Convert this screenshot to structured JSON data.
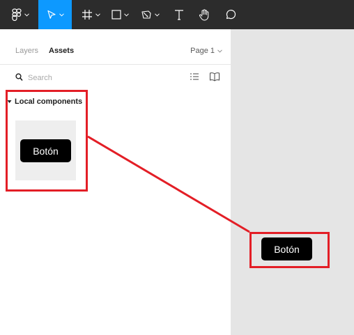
{
  "toolbar": {
    "tools": [
      {
        "name": "main-menu",
        "icon": "figma-logo-icon",
        "dropdown": true
      },
      {
        "name": "move",
        "icon": "cursor-arrow-icon",
        "dropdown": true,
        "active": true
      },
      {
        "name": "frame",
        "icon": "frame-hash-icon",
        "dropdown": true
      },
      {
        "name": "shape",
        "icon": "rectangle-icon",
        "dropdown": true
      },
      {
        "name": "pen",
        "icon": "pen-icon",
        "dropdown": true
      },
      {
        "name": "text",
        "icon": "text-T-icon",
        "dropdown": false
      },
      {
        "name": "hand",
        "icon": "hand-icon",
        "dropdown": false
      },
      {
        "name": "comment",
        "icon": "comment-bubble-icon",
        "dropdown": false
      }
    ],
    "active_color": "#0d99ff",
    "bg_color": "#2c2c2c"
  },
  "panel": {
    "tabs": {
      "layers": "Layers",
      "assets": "Assets"
    },
    "page_selector": "Page 1",
    "search": {
      "placeholder": "Search",
      "value": ""
    },
    "section": {
      "title": "Local components",
      "expanded": true
    },
    "component": {
      "label": "Botón"
    }
  },
  "canvas": {
    "instance_label": "Botón",
    "bg_color": "#e5e5e5"
  },
  "annotation": {
    "color": "#e31e26"
  }
}
